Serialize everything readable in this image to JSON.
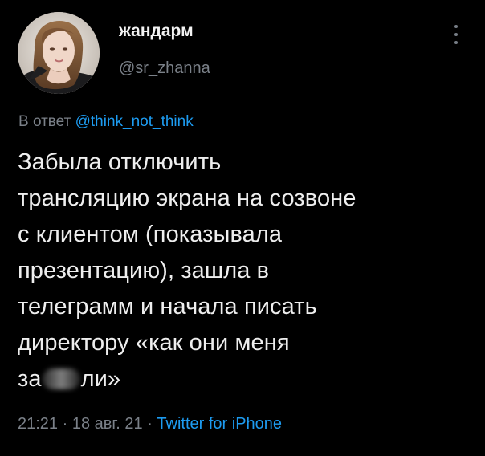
{
  "colors": {
    "background": "#000000",
    "text": "#eeeeee",
    "muted": "#7b8189",
    "accent": "#1d9bf0"
  },
  "author": {
    "display_name": "жандарм",
    "handle": "@sr_zhanna",
    "avatar": "profile-photo"
  },
  "menu_icon": "more-vertical-icon",
  "reply": {
    "prefix": "В ответ",
    "mention": "@think_not_think"
  },
  "tweet": {
    "lines": [
      "Забыла отключить",
      "трансляцию экрана на созвоне",
      "с клиентом (показывала",
      "презентацию), зашла в",
      "телеграмм и начала писать",
      "директору «как они меня"
    ],
    "last_line_start": "за",
    "last_line_end": "ли»"
  },
  "meta": {
    "time": "21:21",
    "separator1": "·",
    "date": "18 авг. 21",
    "separator2": "·",
    "source": "Twitter for iPhone"
  }
}
